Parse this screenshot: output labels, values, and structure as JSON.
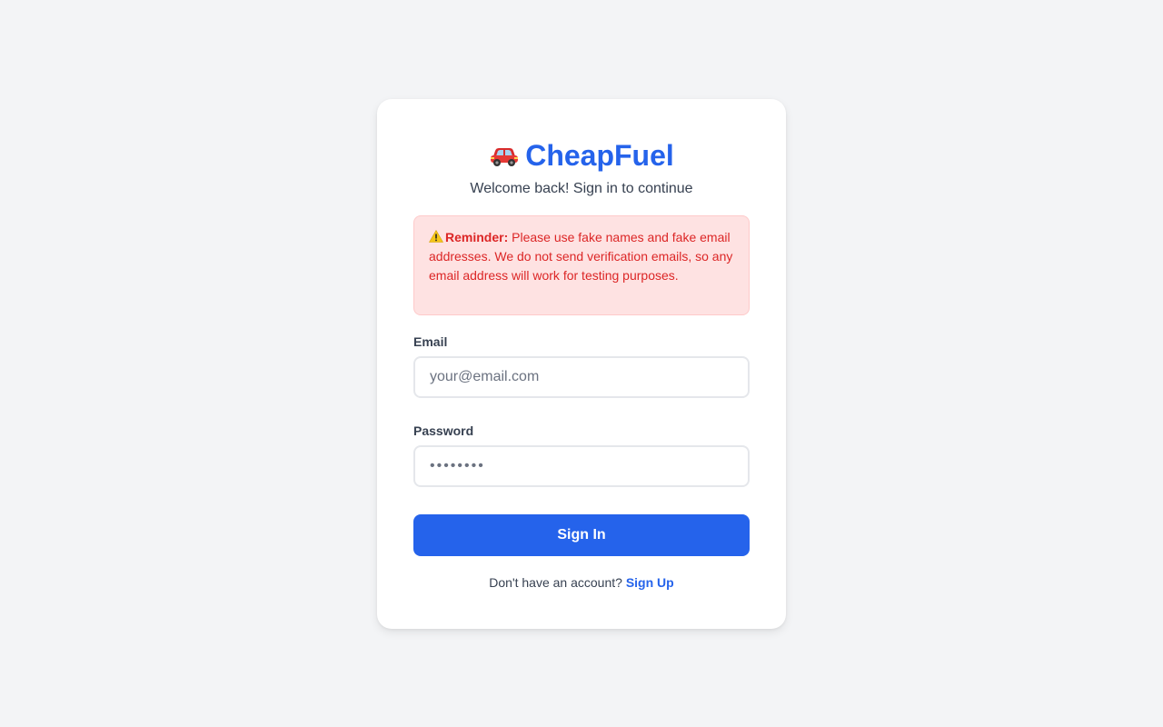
{
  "brand": {
    "icon": "car-icon",
    "name": "CheapFuel",
    "subtitle": "Welcome back! Sign in to continue"
  },
  "alert": {
    "icon": "warning-icon",
    "title": "Reminder:",
    "message": " Please use fake names and fake email addresses. We do not send verification emails, so any email address will work for testing purposes."
  },
  "form": {
    "email_label": "Email",
    "email_placeholder": "your@email.com",
    "email_value": "",
    "password_label": "Password",
    "password_value": "••••••••",
    "submit_label": "Sign In"
  },
  "footer": {
    "prompt": "Don't have an account? ",
    "link_label": "Sign Up"
  },
  "colors": {
    "primary": "#2563eb",
    "background": "#f3f4f6",
    "alert_bg": "#fee2e2",
    "alert_text": "#dc2626"
  }
}
